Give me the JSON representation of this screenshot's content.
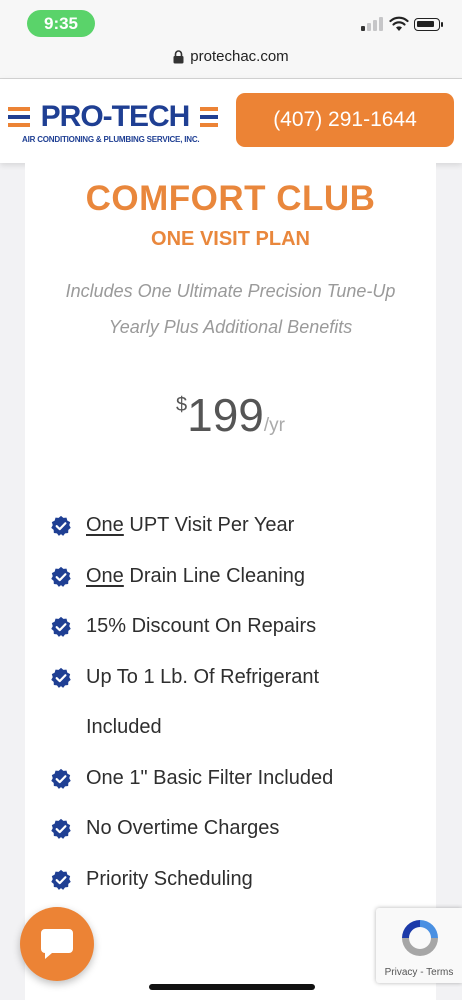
{
  "status_bar": {
    "time": "9:35"
  },
  "browser": {
    "url": "protechac.com"
  },
  "header": {
    "logo_text": "PRO-TECH",
    "logo_subtitle": "AIR CONDITIONING & PLUMBING SERVICE, INC.",
    "phone_label": "(407) 291-1644"
  },
  "plan": {
    "title": "COMFORT CLUB",
    "subtitle": "ONE VISIT PLAN",
    "description_line1": "Includes One Ultimate Precision Tune-Up",
    "description_line2": "Yearly Plus Additional Benefits",
    "price": {
      "currency": "$",
      "amount": "199",
      "period": "/yr"
    },
    "features": [
      {
        "emphasis": "One",
        "text": " UPT Visit Per Year"
      },
      {
        "emphasis": "One",
        "text": " Drain Line Cleaning"
      },
      {
        "text": "15% Discount On Repairs"
      },
      {
        "text_line1": "Up To 1 Lb. Of Refrigerant",
        "text_line2": "Included"
      },
      {
        "text": "One 1\" Basic Filter Included"
      },
      {
        "text": "No Overtime Charges"
      },
      {
        "text": "Priority Scheduling"
      }
    ]
  },
  "recaptcha": {
    "links": "Privacy - Terms"
  },
  "colors": {
    "accent": "#ec8335",
    "brand_blue": "#1f3f93",
    "check": "#1f3f93"
  },
  "icons": [
    "lock-icon",
    "check-badge-icon",
    "chat-bubble-icon",
    "recaptcha-icon",
    "wifi-icon",
    "battery-icon",
    "signal-icon"
  ]
}
